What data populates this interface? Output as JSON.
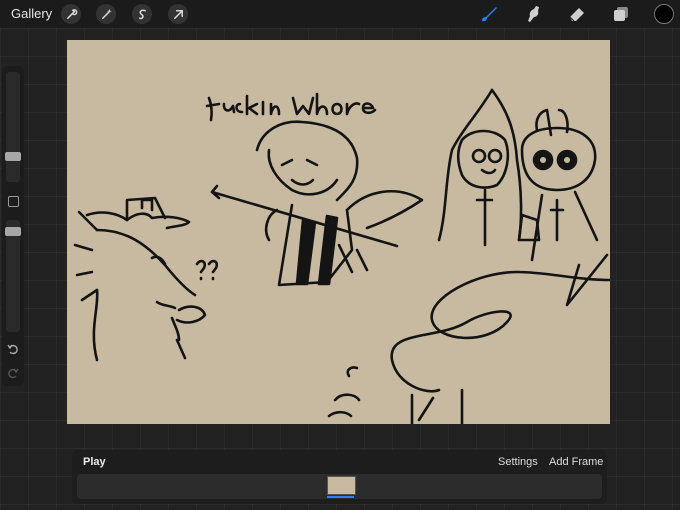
{
  "topbar": {
    "gallery_label": "Gallery",
    "left_tools": [
      "wrench-icon",
      "magic-wand-icon",
      "selection-icon",
      "transform-arrow-icon"
    ],
    "right_tools": [
      "brush-icon",
      "smudge-icon",
      "eraser-icon",
      "layers-icon"
    ],
    "accent_color": "#2f7df6",
    "current_color": "#000000"
  },
  "sidebar": {
    "items": [
      "brush-size-slider",
      "modify-button",
      "opacity-slider",
      "undo-icon",
      "redo-icon"
    ]
  },
  "canvas": {
    "background": "#c7baa1",
    "handwritten_text": "Fuckin whore",
    "side_mark": "??"
  },
  "animation": {
    "play_label": "Play",
    "settings_label": "Settings",
    "add_frame_label": "Add Frame",
    "frame_count": 1,
    "selected_frame": 1
  }
}
